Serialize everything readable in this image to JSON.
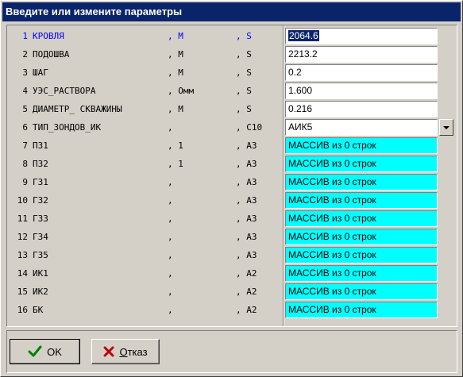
{
  "window": {
    "title": "Введите или измените параметры"
  },
  "params": [
    {
      "num": "1",
      "name": "КРОВЛЯ",
      "unit": ", М",
      "type": ", S",
      "value": "2064.6",
      "kind": "text",
      "active": true,
      "selected": true
    },
    {
      "num": "2",
      "name": "ПОДОШВА",
      "unit": ", М",
      "type": ", S",
      "value": "2213.2",
      "kind": "text"
    },
    {
      "num": "3",
      "name": "ШАГ",
      "unit": ", М",
      "type": ", S",
      "value": "0.2",
      "kind": "text"
    },
    {
      "num": "4",
      "name": "УЭС_РАСТВОРА",
      "unit": ", Омм",
      "type": ", S",
      "value": "1.600",
      "kind": "text"
    },
    {
      "num": "5",
      "name": "ДИАМЕТР_ СКВАЖИНЫ",
      "unit": ", М",
      "type": ", S",
      "value": "0.216",
      "kind": "text"
    },
    {
      "num": "6",
      "name": "ТИП_ЗОНДОВ_ИК",
      "unit": ",",
      "type": ", C10",
      "value": "АИК5",
      "kind": "combo"
    },
    {
      "num": "7",
      "name": "ПЗ1",
      "unit": ", 1",
      "type": ", A3",
      "value": "МАССИВ из 0 строк",
      "kind": "array"
    },
    {
      "num": "8",
      "name": "ПЗ2",
      "unit": ", 1",
      "type": ", A3",
      "value": "МАССИВ из 0 строк",
      "kind": "array"
    },
    {
      "num": "9",
      "name": "ГЗ1",
      "unit": ",",
      "type": ", A3",
      "value": "МАССИВ из 0 строк",
      "kind": "array"
    },
    {
      "num": "10",
      "name": "ГЗ2",
      "unit": ",",
      "type": ", A3",
      "value": "МАССИВ из 0 строк",
      "kind": "array"
    },
    {
      "num": "11",
      "name": "ГЗ3",
      "unit": ",",
      "type": ", A3",
      "value": "МАССИВ из 0 строк",
      "kind": "array"
    },
    {
      "num": "12",
      "name": "ГЗ4",
      "unit": ",",
      "type": ", A3",
      "value": "МАССИВ из 0 строк",
      "kind": "array"
    },
    {
      "num": "13",
      "name": "ГЗ5",
      "unit": ",",
      "type": ", A3",
      "value": "МАССИВ из 0 строк",
      "kind": "array"
    },
    {
      "num": "14",
      "name": "ИК1",
      "unit": ",",
      "type": ", A2",
      "value": "МАССИВ из 0 строк",
      "kind": "array"
    },
    {
      "num": "15",
      "name": "ИК2",
      "unit": ",",
      "type": ", A2",
      "value": "МАССИВ из 0 строк",
      "kind": "array"
    },
    {
      "num": "16",
      "name": "БК",
      "unit": ",",
      "type": ", A2",
      "value": "МАССИВ из 0 строк",
      "kind": "array"
    }
  ],
  "buttons": {
    "ok": {
      "label": "OK",
      "icon": "check-icon",
      "color": "#008000"
    },
    "cancel": {
      "label_accel": "О",
      "label_rest": "тказ",
      "icon": "cross-icon",
      "color": "#c00000"
    }
  },
  "colors": {
    "title_bar": "#0a246a",
    "array_field": "#00ffff",
    "active_row": "#0000ff"
  }
}
